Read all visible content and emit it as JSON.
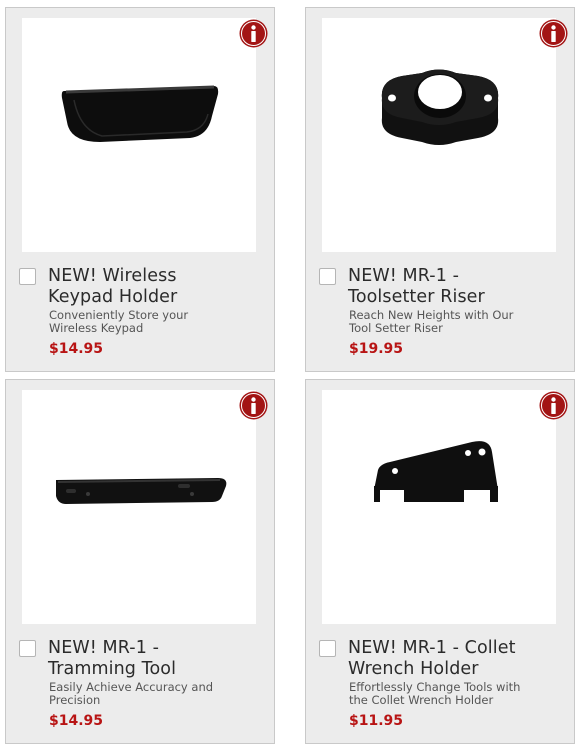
{
  "colors": {
    "card_bg": "#ececec",
    "price": "#b81414",
    "info_icon": "#a31414"
  },
  "products": [
    {
      "title_line1": "NEW! Wireless",
      "title_line2": "Keypad Holder",
      "desc_line1": "Conveniently Store your",
      "desc_line2": "Wireless Keypad",
      "price": "$14.95",
      "image_icon": "keypad-holder-image"
    },
    {
      "title_line1": "NEW! MR-1 -",
      "title_line2": "Toolsetter Riser",
      "desc_line1": "Reach New Heights with Our",
      "desc_line2": "Tool Setter Riser",
      "price": "$19.95",
      "image_icon": "toolsetter-riser-image"
    },
    {
      "title_line1": "NEW! MR-1 -",
      "title_line2": "Tramming Tool",
      "desc_line1": "Easily Achieve Accuracy and",
      "desc_line2": "Precision",
      "price": "$14.95",
      "image_icon": "tramming-tool-image"
    },
    {
      "title_line1": "NEW! MR-1 - Collet",
      "title_line2": "Wrench Holder",
      "desc_line1": "Effortlessly Change Tools with",
      "desc_line2": "the Collet Wrench Holder",
      "price": "$11.95",
      "image_icon": "collet-wrench-holder-image"
    }
  ]
}
